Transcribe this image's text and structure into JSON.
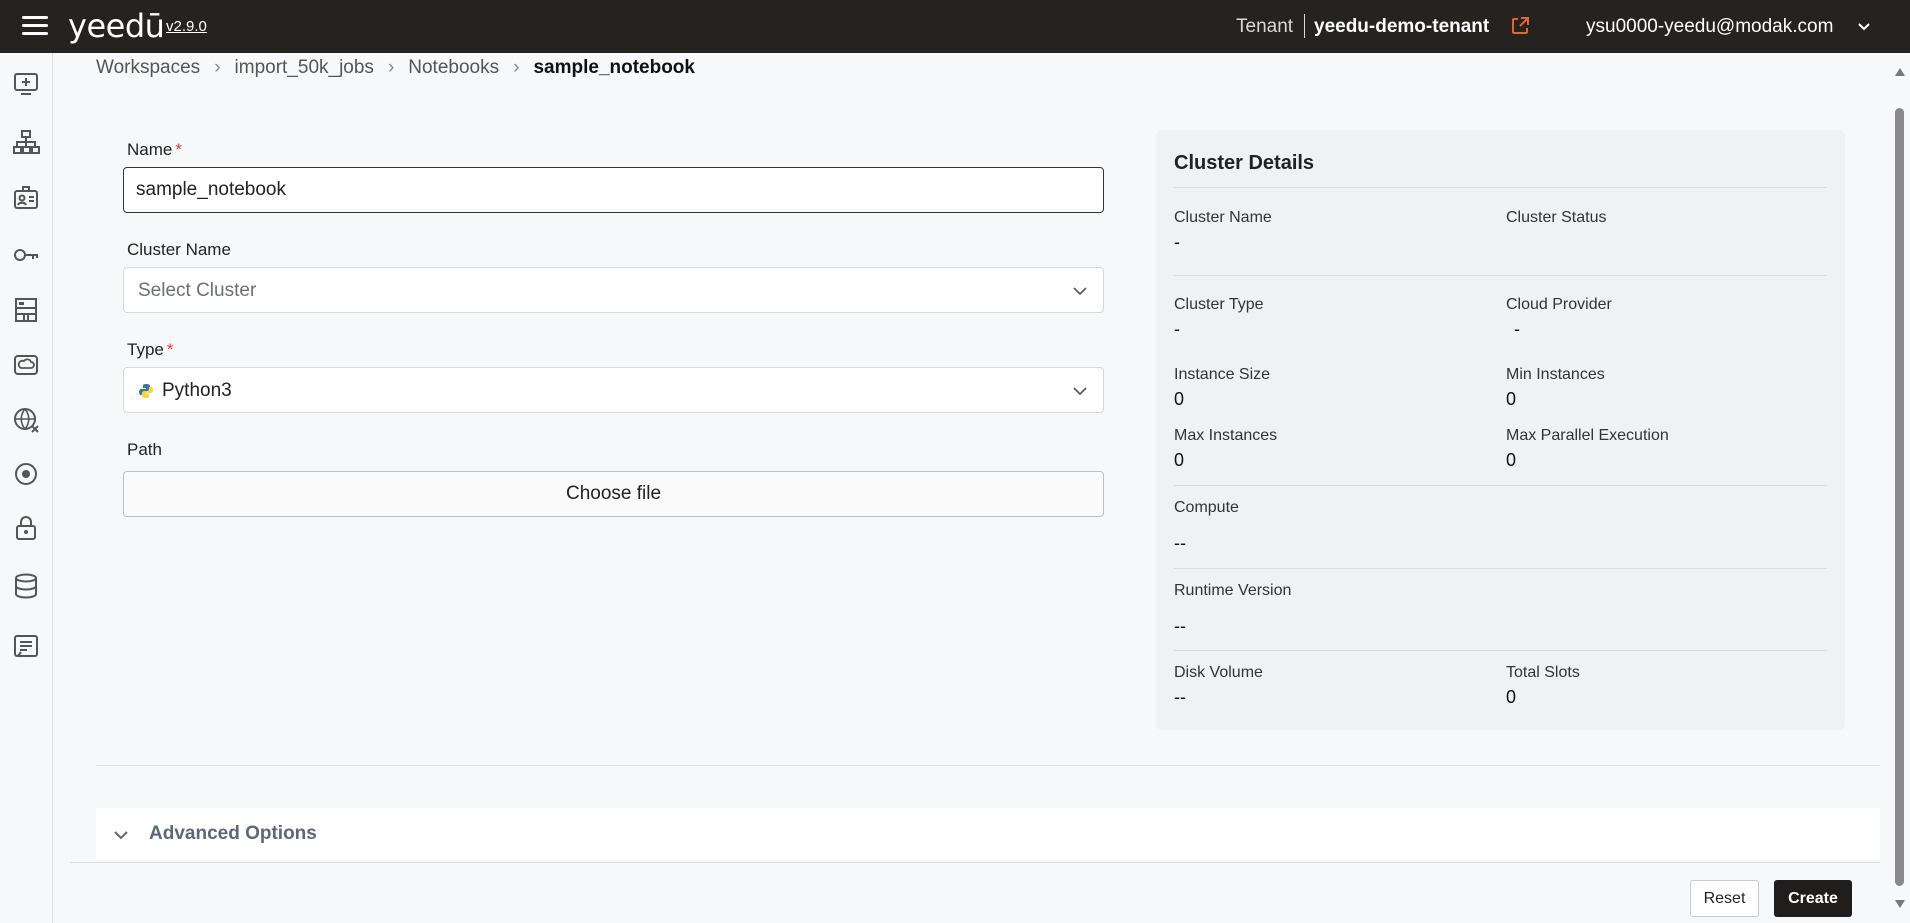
{
  "topbar": {
    "logo": "yeedū",
    "version": "v2.9.0",
    "tenant_label": "Tenant",
    "tenant_name": "yeedu-demo-tenant",
    "user_email": "ysu0000-yeedu@modak.com",
    "accent_color": "#e8622c"
  },
  "sidebar": {
    "icons": [
      "add-workspace-icon",
      "hierarchy-icon",
      "id-card-icon",
      "key-icon",
      "building-icon",
      "cloud-drive-icon",
      "globe-icon",
      "target-icon",
      "lock-icon",
      "database-icon",
      "notes-icon"
    ]
  },
  "breadcrumb": {
    "items": [
      "Workspaces",
      "import_50k_jobs",
      "Notebooks",
      "sample_notebook"
    ]
  },
  "form": {
    "name_label": "Name",
    "name_value": "sample_notebook",
    "required_mark": "*",
    "cluster_label": "Cluster Name",
    "cluster_placeholder": "Select Cluster",
    "type_label": "Type",
    "type_value": "Python3",
    "path_label": "Path",
    "choose_file": "Choose file"
  },
  "cluster_details": {
    "title": "Cluster Details",
    "fields": {
      "cluster_name": {
        "label": "Cluster Name",
        "value": "-"
      },
      "cluster_status": {
        "label": "Cluster Status",
        "value": ""
      },
      "cluster_type": {
        "label": "Cluster Type",
        "value": "-"
      },
      "cloud_provider": {
        "label": "Cloud Provider",
        "value": "-"
      },
      "instance_size": {
        "label": "Instance Size",
        "value": "0"
      },
      "min_instances": {
        "label": "Min Instances",
        "value": "0"
      },
      "max_instances": {
        "label": "Max Instances",
        "value": "0"
      },
      "max_parallel": {
        "label": "Max Parallel Execution",
        "value": "0"
      },
      "compute": {
        "label": "Compute",
        "value": "--"
      },
      "runtime_version": {
        "label": "Runtime Version",
        "value": "--"
      },
      "disk_volume": {
        "label": "Disk Volume",
        "value": "--"
      },
      "total_slots": {
        "label": "Total Slots",
        "value": "0"
      }
    }
  },
  "advanced": {
    "label": "Advanced Options"
  },
  "actions": {
    "reset": "Reset",
    "create": "Create"
  }
}
